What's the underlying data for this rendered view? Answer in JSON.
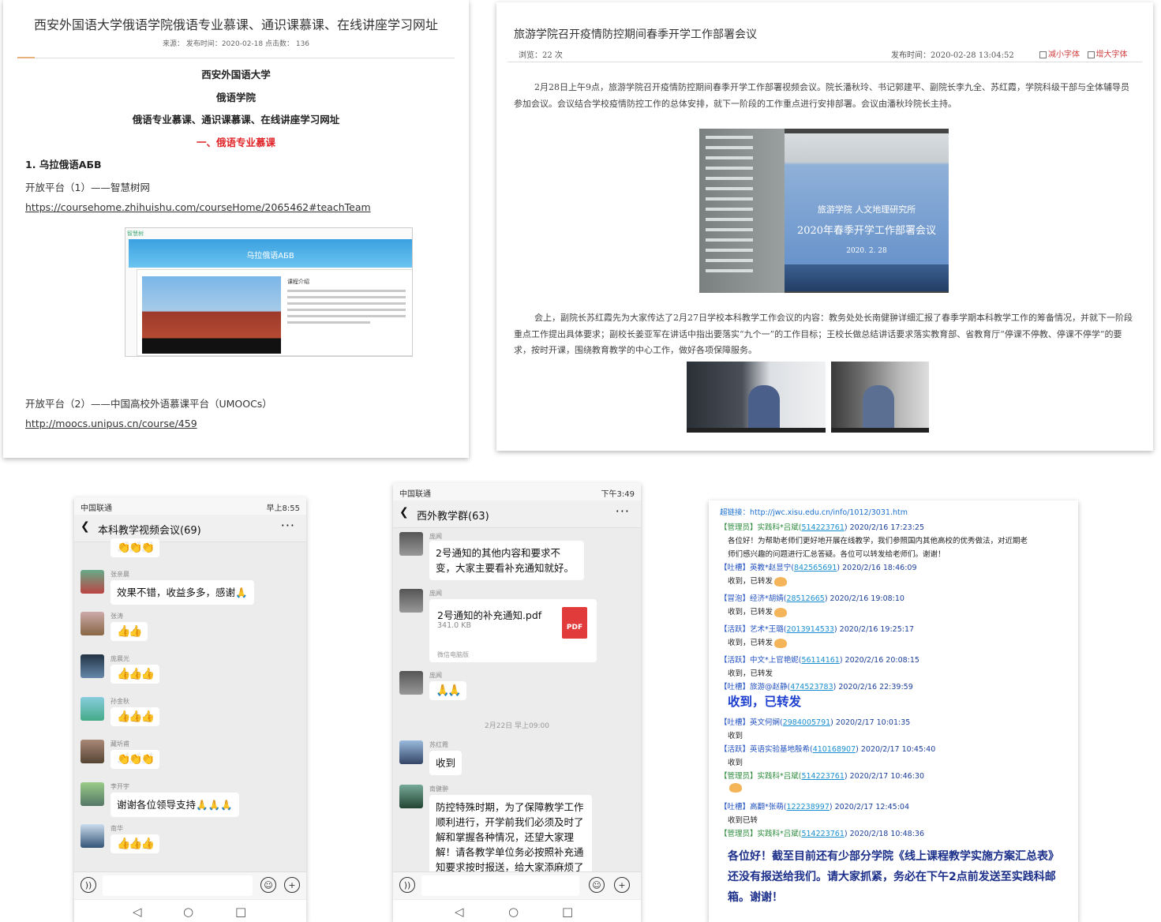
{
  "panel1": {
    "title": "西安外国语大学俄语学院俄语专业慕课、通识课慕课、在线讲座学习网址",
    "meta": "来源：    发布时间：2020-02-18    点击数：  136",
    "heading1": "西安外国语大学",
    "heading2": "俄语学院",
    "heading3": "俄语专业慕课、通识课慕课、在线讲座学习网址",
    "section1": "一、俄语专业慕课",
    "item1": "1. 乌拉俄语АБВ",
    "platform1": "开放平台（1）——智慧树网",
    "link1": "https://coursehome.zhihuishu.com/courseHome/2065462#teachTeam",
    "course_banner": "乌拉俄语АБВ",
    "course_intro": "课程介绍",
    "site_logo": "智慧树",
    "platform2": "开放平台（2）——中国高校外语慕课平台（UMOOCs）",
    "link2": "http://moocs.unipus.cn/course/459"
  },
  "panel2": {
    "title": "旅游学院召开疫情防控期间春季开学工作部署会议",
    "views": "浏览：22 次",
    "published": "发布时间：2020-02-28 13:04:52",
    "font_smaller": "减小字体",
    "font_larger": "增大字体",
    "para1": "2月28日上午9点，旅游学院召开疫情防控期间春季开学工作部署视频会议。院长潘秋玲、书记郭建平、副院长李九全、苏红霞，学院科级干部与全体辅导员参加会议。会议结合学校疫情防控工作的总体安排，就下一阶段的工作重点进行安排部署。会议由潘秋玲院长主持。",
    "screen_line1": "旅游学院  人文地理研究所",
    "screen_line2": "2020年春季开学工作部署会议",
    "screen_line3": "2020. 2. 28",
    "para2": "会上，副院长苏红霞先为大家传达了2月27日学校本科教学工作会议的内容：教务处处长南健翀详细汇报了春季学期本科教学工作的筹备情况，并就下一阶段重点工作提出具体要求；副校长姜亚军在讲话中指出要落实“九个一”的工作目标；王校长做总结讲话要求落实教育部、省教育厅“停课不停教、停课不停学”的要求，按时开课，围绕教育教学的中心工作，做好各项保障服务。"
  },
  "phone1": {
    "carrier": "中国联通",
    "time": "早上8:55",
    "chat_title": "本科教学视频会议(69)",
    "messages": [
      {
        "name": "",
        "text": "👏👏👏"
      },
      {
        "name": "张亲晨",
        "text": "效果不错，收益多多，感谢🙏"
      },
      {
        "name": "张涛",
        "text": "👍👍"
      },
      {
        "name": "庞晨光",
        "text": "👍👍👍"
      },
      {
        "name": "孙金秋",
        "text": "👍👍👍"
      },
      {
        "name": "藏圻甫",
        "text": "👏👏👏"
      },
      {
        "name": "李开宇",
        "text": "谢谢各位领导支持🙏🙏🙏"
      },
      {
        "name": "南华",
        "text": "👍👍👍"
      }
    ]
  },
  "phone2": {
    "carrier": "中国联通",
    "time": "下午3:49",
    "chat_title": "西外教学群(63)",
    "m1_name": "庞闻",
    "m1_text": "2号通知的其他内容和要求不变，大家主要看补充通知就好。",
    "m2_name": "庞闻",
    "file_name": "2号通知的补充通知.pdf",
    "file_size": "341.0 KB",
    "file_badge": "PDF",
    "file_source": "微信电脑版",
    "m3_name": "庞闻",
    "m3_text": "🙏🙏",
    "timestamp": "2月22日 早上09:00",
    "m4_name": "苏红霞",
    "m4_text": "收到",
    "m5_name": "南健翀",
    "m5_text": "防控特殊时期，为了保障教学工作顺利进行，开学前我们必须及时了解和掌握各种情况，还望大家理解！请各教学单位务必按照补充通知要求按时报送，给大家添麻烦了"
  },
  "panel5": {
    "top": "超链接：http://jwc.xisu.edu.cn/info/1012/3031.htm",
    "rows": [
      {
        "tag": "【管理员】实践科*吕斌(",
        "qq": "514223761",
        "time": ") 2020/2/16 17:23:25",
        "kind": "m"
      },
      {
        "msg": "各位好！为帮助老师们更好地开展在线教学，我们参照国内其他高校的优秀做法，对近期老"
      },
      {
        "msg": "师们感兴趣的问题进行汇总答疑。各位可以转发给老师们。谢谢！"
      },
      {
        "tag": "【吐槽】英教*赵显宁(",
        "qq": "842565691",
        "time": ") 2020/2/16 18:46:09",
        "kind": "t"
      },
      {
        "msg": "收到，已转发",
        "hand": true
      },
      {
        "tag": "【冒泡】经济*胡婧(",
        "qq": "28512665",
        "time": ") 2020/2/16 19:08:10",
        "kind": "t"
      },
      {
        "msg": "收到，已转发",
        "hand": true
      },
      {
        "tag": "【活跃】艺术*王璐(",
        "qq": "2013914533",
        "time": ") 2020/2/16 19:25:17",
        "kind": "t"
      },
      {
        "msg": "收到，已转发",
        "hand": true
      },
      {
        "tag": "【活跃】中文*上官艳妮(",
        "qq": "56114161",
        "time": ") 2020/2/16 20:08:15",
        "kind": "t"
      },
      {
        "msg": "收到，已转发"
      },
      {
        "tag": "【吐槽】旅游@赵静(",
        "qq": "474523783",
        "time": ") 2020/2/16 22:39:59",
        "kind": "t"
      },
      {
        "big": "收到，已转发"
      },
      {
        "tag": "【吐槽】英文何娴(",
        "qq": "2984005791",
        "time": ") 2020/2/17 10:01:35",
        "kind": "t"
      },
      {
        "msg": "收到"
      },
      {
        "tag": "【活跃】英语实验基地殷希(",
        "qq": "410168907",
        "time": ") 2020/2/17 10:45:40",
        "kind": "t"
      },
      {
        "msg": "收到"
      },
      {
        "tag": "【管理员】实践科*吕斌(",
        "qq": "514223761",
        "time": ") 2020/2/17 10:46:30",
        "kind": "m"
      },
      {
        "msg": "",
        "hand": true
      },
      {
        "tag": "【吐槽】高翻*张萌(",
        "qq": "122238997",
        "time": ") 2020/2/17 12:45:04",
        "kind": "t"
      },
      {
        "msg": "收到已转"
      },
      {
        "tag": "【管理员】实践科*吕斌(",
        "qq": "514223761",
        "time": ") 2020/2/18 10:48:36",
        "kind": "m"
      }
    ],
    "final": "各位好！截至目前还有少部分学院《线上课程教学实施方案汇总表》还没有报送给我们。请大家抓紧，务必在下午2点前发送至实践科邮箱。谢谢！"
  }
}
